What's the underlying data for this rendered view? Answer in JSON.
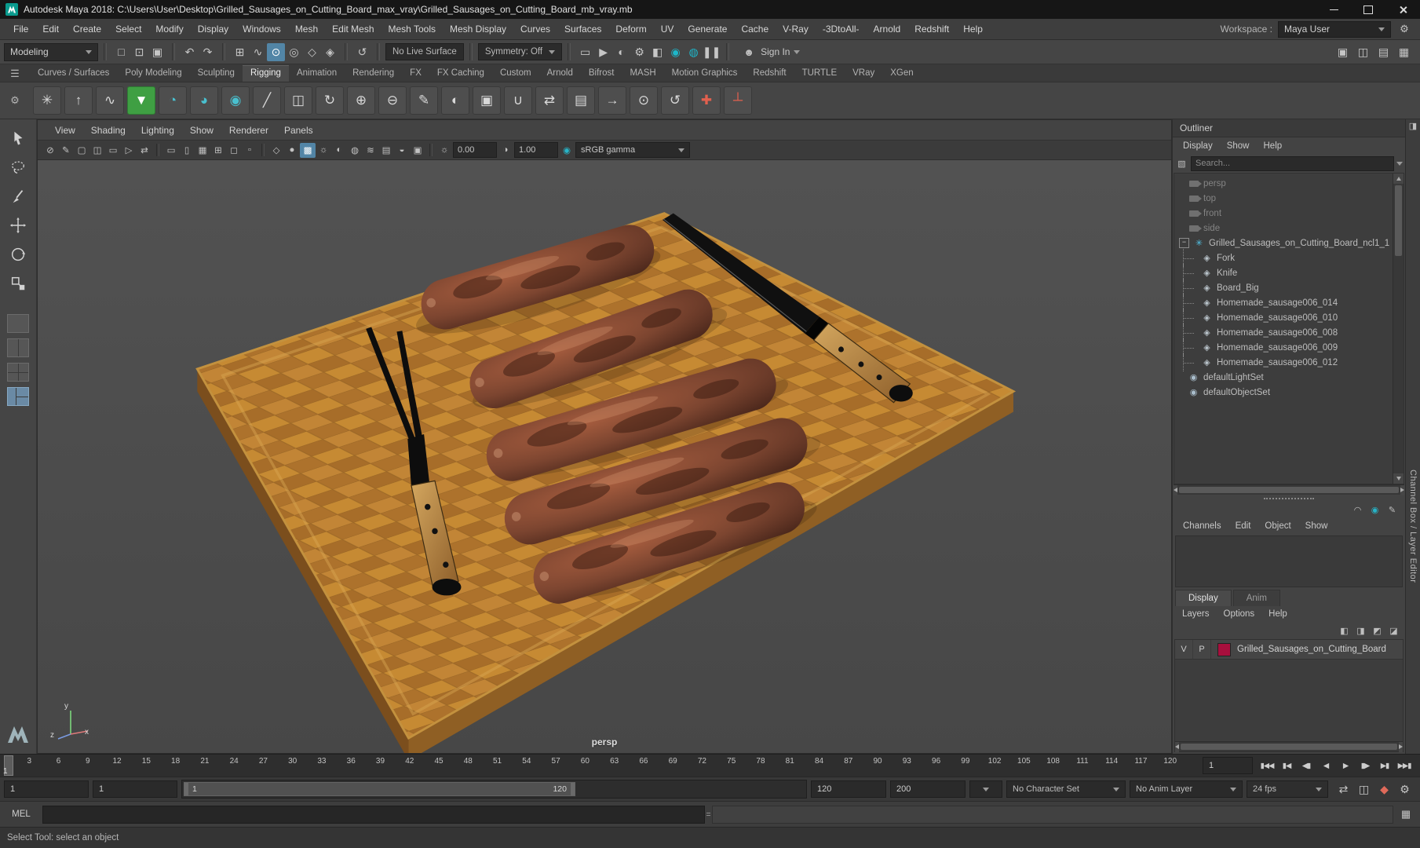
{
  "window": {
    "title": "Autodesk Maya 2018: C:\\Users\\User\\Desktop\\Grilled_Sausages_on_Cutting_Board_max_vray\\Grilled_Sausages_on_Cutting_Board_mb_vray.mb"
  },
  "menubar": {
    "items": [
      "File",
      "Edit",
      "Create",
      "Select",
      "Modify",
      "Display",
      "Windows",
      "Mesh",
      "Edit Mesh",
      "Mesh Tools",
      "Mesh Display",
      "Curves",
      "Surfaces",
      "Deform",
      "UV",
      "Generate",
      "Cache",
      "V-Ray",
      "-3DtoAll-",
      "Arnold",
      "Redshift",
      "Help"
    ],
    "workspace_label": "Workspace :",
    "workspace_value": "Maya User",
    "gear_icon": "⚙"
  },
  "toolbar": {
    "mode": "Modeling",
    "live_surface": "No Live Surface",
    "symmetry": "Symmetry: Off",
    "sign_in": "Sign In",
    "signin_icon": "☻",
    "icons_file": [
      {
        "name": "new-scene-icon",
        "glyph": "□"
      },
      {
        "name": "open-scene-icon",
        "glyph": "⊡"
      },
      {
        "name": "save-scene-icon",
        "glyph": "▣"
      }
    ],
    "icons_undo": [
      {
        "name": "undo-icon",
        "glyph": "↶"
      },
      {
        "name": "redo-icon",
        "glyph": "↷"
      }
    ],
    "icons_snap": [
      {
        "name": "snap-grid-icon",
        "glyph": "⊞"
      },
      {
        "name": "snap-curve-icon",
        "glyph": "∿"
      },
      {
        "name": "snap-point-icon",
        "glyph": "⊙",
        "mod": "active"
      },
      {
        "name": "snap-projected-center-icon",
        "glyph": "◎"
      },
      {
        "name": "snap-view-plane-icon",
        "glyph": "◇"
      },
      {
        "name": "make-live-icon",
        "glyph": "◈"
      }
    ],
    "icons_history": [
      {
        "name": "construction-history-icon",
        "glyph": "↺"
      }
    ],
    "icons_render": [
      {
        "name": "open-render-view-icon",
        "glyph": "▭"
      },
      {
        "name": "render-current-frame-icon",
        "glyph": "▶"
      },
      {
        "name": "ipr-render-icon",
        "glyph": "◐"
      },
      {
        "name": "render-settings-icon",
        "glyph": "⚙"
      },
      {
        "name": "hypershade-icon",
        "glyph": "◧"
      },
      {
        "name": "render-globe-icon",
        "glyph": "◉",
        "mod": "teal"
      },
      {
        "name": "launch-render-icon",
        "glyph": "◍",
        "mod": "teal"
      },
      {
        "name": "pause-icon",
        "glyph": "❚❚"
      }
    ],
    "icons_right": [
      {
        "name": "single-pane-layout-icon",
        "glyph": "▣"
      },
      {
        "name": "panel-toggle-icon",
        "glyph": "◫"
      },
      {
        "name": "attribute-editor-toggle-icon",
        "glyph": "▤"
      },
      {
        "name": "channel-box-toggle-icon",
        "glyph": "▦"
      }
    ]
  },
  "shelf": {
    "menu_icon": "☰",
    "gear_icon": "⚙",
    "tabs": [
      "Curves / Surfaces",
      "Poly Modeling",
      "Sculpting",
      "Rigging",
      "Animation",
      "Rendering",
      "FX",
      "FX Caching",
      "Custom",
      "Arnold",
      "Bifrost",
      "MASH",
      "Motion Graphics",
      "Redshift",
      "TURTLE",
      "VRay",
      "XGen"
    ],
    "active_tab": "Rigging",
    "icons": [
      {
        "name": "joint-tool-icon",
        "glyph": "✳"
      },
      {
        "name": "ik-handle-icon",
        "glyph": "↑"
      },
      {
        "name": "ik-spline-icon",
        "glyph": "∿"
      },
      {
        "name": "quick-rig-icon",
        "glyph": "▼",
        "mod": "green"
      },
      {
        "name": "humanik-character-icon",
        "glyph": "◔",
        "mod": "teal2"
      },
      {
        "name": "humanik-skeleton-icon",
        "glyph": "◕",
        "mod": "teal2"
      },
      {
        "name": "humanik-control-icon",
        "glyph": "◉",
        "mod": "teal2"
      },
      {
        "name": "insert-joint-icon",
        "glyph": "╱"
      },
      {
        "name": "mirror-joint-icon",
        "glyph": "◫"
      },
      {
        "name": "orient-joint-icon",
        "glyph": "↻"
      },
      {
        "name": "bind-skin-icon",
        "glyph": "⊕"
      },
      {
        "name": "unbind-skin-icon",
        "glyph": "⊖"
      },
      {
        "name": "paint-skin-weights-icon",
        "glyph": "✎"
      },
      {
        "name": "mirror-skin-weights-icon",
        "glyph": "◐"
      },
      {
        "name": "copy-skin-weights-icon",
        "glyph": "▣"
      },
      {
        "name": "smooth-skin-weights-icon",
        "glyph": "∪"
      },
      {
        "name": "blend-shape-icon",
        "glyph": "⇄"
      },
      {
        "name": "pose-editor-icon",
        "glyph": "▤"
      },
      {
        "name": "parent-constraint-icon",
        "glyph": "→"
      },
      {
        "name": "point-constraint-icon",
        "glyph": "⊙"
      },
      {
        "name": "orient-constraint-icon",
        "glyph": "↺"
      },
      {
        "name": "add-influence-icon",
        "glyph": "✚",
        "mod": "red"
      },
      {
        "name": "remove-influence-icon",
        "glyph": "┴",
        "mod": "red"
      }
    ]
  },
  "viewport": {
    "menus": [
      "View",
      "Shading",
      "Lighting",
      "Show",
      "Renderer",
      "Panels"
    ],
    "icons_a": [
      {
        "name": "camera-slash-icon",
        "glyph": "⊘"
      },
      {
        "name": "grease-pencil-icon",
        "glyph": "✎"
      },
      {
        "name": "camera-attributes-icon",
        "glyph": "▢"
      },
      {
        "name": "camera-lock-icon",
        "glyph": "◫"
      },
      {
        "name": "image-plane-icon",
        "glyph": "▭"
      },
      {
        "name": "bookmark-icon",
        "glyph": "▷"
      },
      {
        "name": "pan-zoom-icon",
        "glyph": "⇄"
      }
    ],
    "icons_b": [
      {
        "name": "film-gate-icon",
        "glyph": "▭"
      },
      {
        "name": "resolution-gate-icon",
        "glyph": "▯"
      },
      {
        "name": "gate-mask-icon",
        "glyph": "▦"
      },
      {
        "name": "field-chart-icon",
        "glyph": "⊞"
      },
      {
        "name": "safe-action-icon",
        "glyph": "◻"
      },
      {
        "name": "safe-title-icon",
        "glyph": "▫"
      }
    ],
    "icons_c": [
      {
        "name": "wireframe-icon",
        "glyph": "◇"
      },
      {
        "name": "shaded-icon",
        "glyph": "●"
      },
      {
        "name": "textured-icon",
        "glyph": "▩",
        "mod": "active"
      },
      {
        "name": "lights-icon",
        "glyph": "☼"
      },
      {
        "name": "shadows-icon",
        "glyph": "◐"
      },
      {
        "name": "occlusion-icon",
        "glyph": "◍"
      },
      {
        "name": "motion-blur-icon",
        "glyph": "≋"
      },
      {
        "name": "multisample-icon",
        "glyph": "▤"
      },
      {
        "name": "xray-icon",
        "glyph": "◒"
      },
      {
        "name": "isolate-select-icon",
        "glyph": "▣"
      }
    ],
    "exposure_icon": "☼",
    "contrast_icon": "◑",
    "gamma_icon": "◉",
    "exposure": "0.00",
    "contrast": "1.00",
    "color_profile": "sRGB gamma",
    "camera": "persp",
    "axis": {
      "x": "x",
      "y": "y",
      "z": "z"
    }
  },
  "outliner": {
    "title": "Outliner",
    "menus": [
      "Display",
      "Show",
      "Help"
    ],
    "search_placeholder": "Search...",
    "filter_icon": "▧",
    "items": [
      {
        "label": "persp",
        "type": "camera",
        "dim": true
      },
      {
        "label": "top",
        "type": "camera",
        "dim": true
      },
      {
        "label": "front",
        "type": "camera",
        "dim": true
      },
      {
        "label": "side",
        "type": "camera",
        "dim": true
      },
      {
        "label": "Grilled_Sausages_on_Cutting_Board_ncl1_1",
        "type": "group"
      },
      {
        "label": "Fork",
        "type": "mesh",
        "child": true
      },
      {
        "label": "Knife",
        "type": "mesh",
        "child": true
      },
      {
        "label": "Board_Big",
        "type": "mesh",
        "child": true
      },
      {
        "label": "Homemade_sausage006_014",
        "type": "mesh",
        "child": true
      },
      {
        "label": "Homemade_sausage006_010",
        "type": "mesh",
        "child": true
      },
      {
        "label": "Homemade_sausage006_008",
        "type": "mesh",
        "child": true
      },
      {
        "label": "Homemade_sausage006_009",
        "type": "mesh",
        "child": true
      },
      {
        "label": "Homemade_sausage006_012",
        "type": "mesh",
        "child": true
      },
      {
        "label": "defaultLightSet",
        "type": "set"
      },
      {
        "label": "defaultObjectSet",
        "type": "set"
      }
    ]
  },
  "channelbox": {
    "strip_icon": "◨",
    "vertical_tab": "Channel Box / Layer Editor",
    "top_icons": [
      {
        "name": "channel-slow-icon",
        "glyph": "◠"
      },
      {
        "name": "channel-speed-icon",
        "glyph": "◉",
        "mod": "teal"
      },
      {
        "name": "channel-edit-icon",
        "glyph": "✎"
      }
    ],
    "menus": [
      "Channels",
      "Edit",
      "Object",
      "Show"
    ],
    "tabs": [
      "Display",
      "Anim"
    ],
    "active_tab": "Display",
    "layer_menus": [
      "Layers",
      "Options",
      "Help"
    ],
    "layer_icons": [
      {
        "name": "layers-toggle-icon",
        "glyph": "◧"
      },
      {
        "name": "layers-sort-icon",
        "glyph": "◨"
      },
      {
        "name": "create-empty-layer-icon",
        "glyph": "◩"
      },
      {
        "name": "create-layer-from-selected-icon",
        "glyph": "◪"
      }
    ],
    "layer": {
      "v": "V",
      "p": "P",
      "name": "Grilled_Sausages_on_Cutting_Board",
      "color": "#a80f3d"
    }
  },
  "timeline": {
    "ticks": [
      3,
      6,
      9,
      12,
      15,
      18,
      21,
      24,
      27,
      30,
      33,
      36,
      39,
      42,
      45,
      48,
      51,
      54,
      57,
      60,
      63,
      66,
      69,
      72,
      75,
      78,
      81,
      84,
      87,
      90,
      93,
      96,
      99,
      102,
      105,
      108,
      111,
      114,
      117,
      120
    ],
    "visible_max": 123,
    "current": "1",
    "current_field": "1",
    "transport": [
      {
        "name": "go-to-start-button",
        "glyph": "▮◀◀"
      },
      {
        "name": "step-back-frame-button",
        "glyph": "▮◀"
      },
      {
        "name": "step-back-key-button",
        "glyph": "◀▮"
      },
      {
        "name": "play-backwards-button",
        "glyph": "◀"
      },
      {
        "name": "play-forwards-button",
        "glyph": "▶"
      },
      {
        "name": "step-forward-key-button",
        "glyph": "▮▶"
      },
      {
        "name": "step-forward-frame-button",
        "glyph": "▶▮"
      },
      {
        "name": "go-to-end-button",
        "glyph": "▶▶▮"
      }
    ]
  },
  "rangebar": {
    "anim_start": "1",
    "playback_start": "1",
    "bar_start_label": "1",
    "bar_end_label": "120",
    "playback_end": "120",
    "anim_end": "200",
    "character_set": "No Character Set",
    "anim_layer": "No Anim Layer",
    "fps": "24 fps",
    "icons": [
      {
        "name": "playback-loop-icon",
        "glyph": "⇄"
      },
      {
        "name": "clamp-playback-icon",
        "glyph": "◫"
      },
      {
        "name": "auto-keyframe-icon",
        "glyph": "◆",
        "mod": "red"
      },
      {
        "name": "animation-preferences-icon",
        "glyph": "⚙"
      }
    ]
  },
  "command": {
    "label": "MEL",
    "script_editor_icon": "▦"
  },
  "helpline": {
    "text": "Select Tool: select an object"
  }
}
